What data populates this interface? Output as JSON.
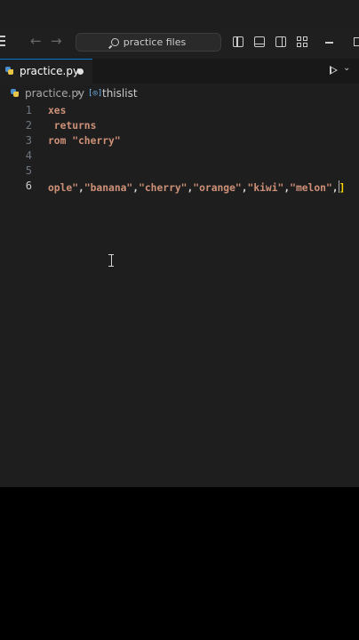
{
  "titlebar": {
    "search_label": "practice files",
    "icons": [
      "menu-icon",
      "arrow-left-icon",
      "arrow-right-icon",
      "search-icon",
      "toggle-primary-sidebar-icon",
      "toggle-panel-icon",
      "toggle-secondary-sidebar-icon",
      "customize-layout-icon",
      "minimize-icon",
      "restore-icon"
    ],
    "back_glyph": "←",
    "forward_glyph": "→"
  },
  "tabs": [
    {
      "label": "practice.py",
      "dirty": true,
      "active": true
    }
  ],
  "run_chevron": "⌄",
  "breadcrumb": {
    "file": "practice.py",
    "separator": "›",
    "symbol_glyph": "[◎]",
    "symbol": "thislist"
  },
  "editor": {
    "lines": [
      {
        "number": "1",
        "text": "xes"
      },
      {
        "number": "2",
        "text": " returns"
      },
      {
        "number": "3",
        "text": "rom \"cherry\""
      },
      {
        "number": "4",
        "text": ""
      },
      {
        "number": "5",
        "text": ""
      },
      {
        "number": "6",
        "parts": [
          "ople\"",
          ",",
          "\"banana\"",
          ",",
          "\"cherry\"",
          ",",
          "\"orange\"",
          ",",
          "\"kiwi\"",
          ",",
          "\"melon\"",
          ",",
          "]"
        ]
      }
    ],
    "active_line": "6"
  },
  "colors": {
    "accent": "#0078d4",
    "string": "#ce9178",
    "comment": "#6a9955",
    "bracket": "#ffd700",
    "editor_bg": "#1e1e1e"
  }
}
